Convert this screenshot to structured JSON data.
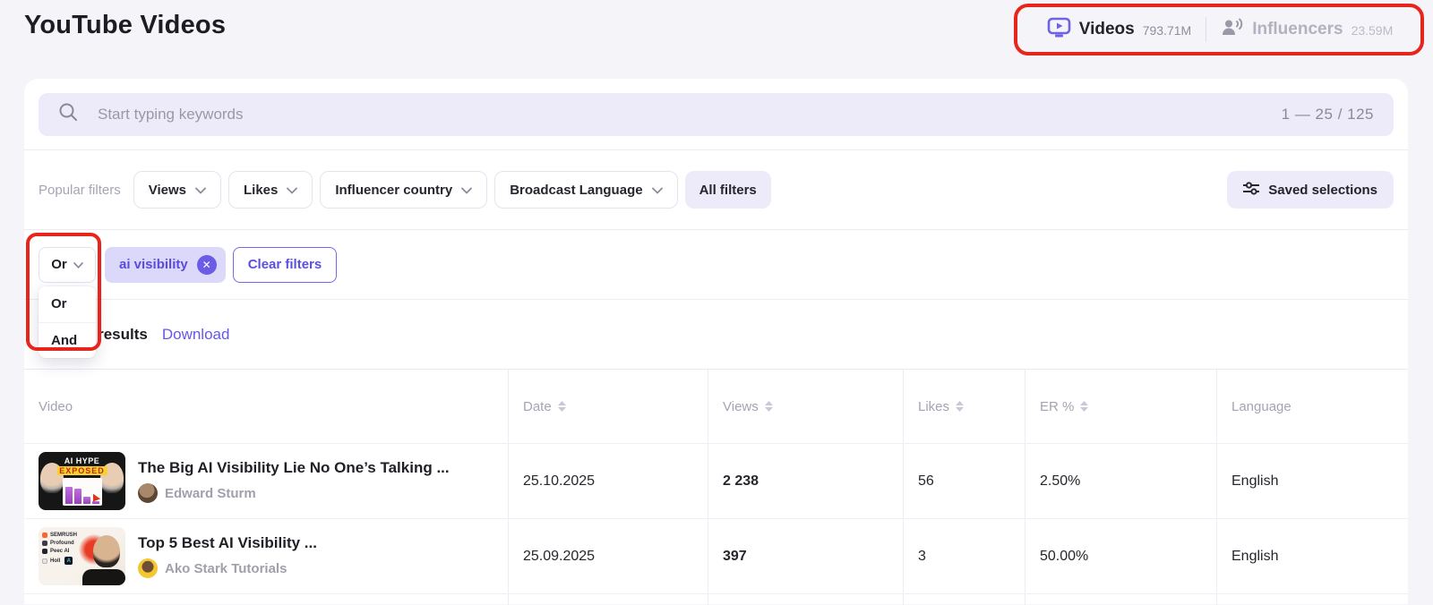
{
  "page": {
    "title": "YouTube Videos"
  },
  "tabs": {
    "videos": {
      "label": "Videos",
      "count": "793.71M"
    },
    "influencers": {
      "label": "Influencers",
      "count": "23.59M"
    }
  },
  "search": {
    "placeholder": "Start typing keywords",
    "range": "1 — 25 / 125"
  },
  "filters": {
    "popular_label": "Popular filters",
    "dropdowns": [
      "Views",
      "Likes",
      "Influencer country",
      "Broadcast Language"
    ],
    "all_filters_label": "All filters",
    "saved_selections_label": "Saved selections"
  },
  "active_filters": {
    "operator_value": "Or",
    "operator_options": [
      "Or",
      "And"
    ],
    "chip_label": "ai visibility",
    "clear_label": "Clear filters"
  },
  "results": {
    "count_text": "125 results",
    "download_label": "Download"
  },
  "table": {
    "columns": [
      {
        "label": "Video",
        "sortable": false
      },
      {
        "label": "Date",
        "sortable": true
      },
      {
        "label": "Views",
        "sortable": true
      },
      {
        "label": "Likes",
        "sortable": true
      },
      {
        "label": "ER %",
        "sortable": true
      },
      {
        "label": "Language",
        "sortable": false
      }
    ],
    "rows": [
      {
        "title": "The Big AI Visibility Lie No One’s Talking ...",
        "channel": "Edward Sturm",
        "date": "25.10.2025",
        "views": "2 238",
        "likes": "56",
        "er": "2.50%",
        "language": "English",
        "thumb": {
          "line1": "AI HYPE",
          "line2": "EXPOSED"
        }
      },
      {
        "title": "Top 5 Best AI Visibility ...",
        "channel": "Ako Stark Tutorials",
        "date": "25.09.2025",
        "views": "397",
        "likes": "3",
        "er": "50.00%",
        "language": "English",
        "thumb": {
          "logos": [
            "SEMRUSH",
            "Profound",
            "Peec AI",
            "Holl"
          ]
        }
      }
    ]
  },
  "icons": {
    "search-icon": "magnifier",
    "videos-tab-icon": "monitor-with-play",
    "influencers-tab-icon": "person-with-sound-waves",
    "chevron-down-icon": "chevron-down",
    "sort-icon": "up-down-triangles",
    "close-icon": "x-in-circle",
    "sliders-icon": "filter-sliders"
  },
  "colors": {
    "accent": "#6558e8",
    "annotation_red": "#e8251d",
    "chip_bg": "#dcd8f9",
    "search_bg": "#edebf9",
    "page_bg": "#f5f4f8"
  }
}
